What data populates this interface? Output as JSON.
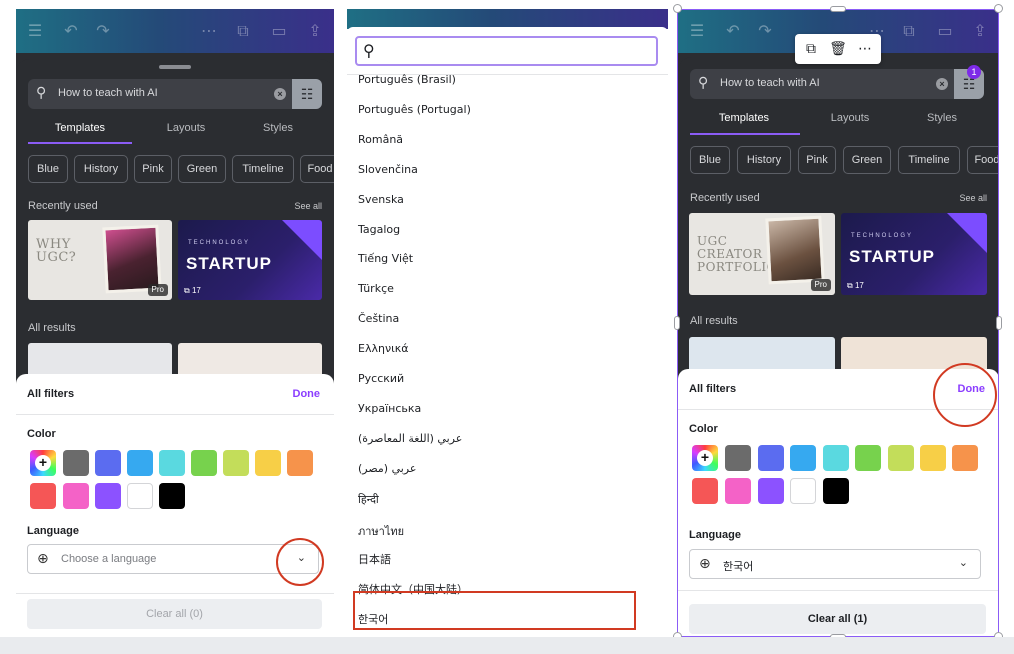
{
  "left": {
    "search_text": "How to teach with AI",
    "tabs": [
      "Templates",
      "Layouts",
      "Styles"
    ],
    "chips": [
      "Blue",
      "History",
      "Pink",
      "Green",
      "Timeline",
      "Food"
    ],
    "recently_used": "Recently used",
    "see_all": "See all",
    "all_results": "All results",
    "thumb_ugc": "WHY\nUGC?",
    "thumb_pro": "Pro",
    "thumb_tech": "TECHNOLOGY",
    "thumb_startup": "STARTUP",
    "thumb_count": "17",
    "filters_title": "All filters",
    "done": "Done",
    "color_label": "Color",
    "language_label": "Language",
    "language_placeholder": "Choose a language",
    "clear_all": "Clear all (0)"
  },
  "middle": {
    "languages": [
      "Português (Brasil)",
      "Português (Portugal)",
      "Română",
      "Slovenčina",
      "Svenska",
      "Tagalog",
      "Tiếng Việt",
      "Türkçe",
      "Čeština",
      "Ελληνικά",
      "Русский",
      "Українська",
      "عربي (اللغة المعاصرة)",
      "عربي (مصر)",
      "हिन्दी",
      "ภาษาไทย",
      "日本語",
      "简体中文（中国大陆）",
      "한국어"
    ]
  },
  "right": {
    "search_text": "How to teach with AI",
    "filter_badge": "1",
    "tabs": [
      "Templates",
      "Layouts",
      "Styles"
    ],
    "chips": [
      "Blue",
      "History",
      "Pink",
      "Green",
      "Timeline",
      "Food"
    ],
    "recently_used": "Recently used",
    "see_all": "See all",
    "all_results": "All results",
    "thumb_ugc": "UGC\nCREATOR\nPORTFOLIO",
    "thumb_pro": "Pro",
    "thumb_tech": "TECHNOLOGY",
    "thumb_startup": "STARTUP",
    "thumb_count": "17",
    "filters_title": "All filters",
    "done": "Done",
    "color_label": "Color",
    "language_label": "Language",
    "language_value": "한국어",
    "clear_all": "Clear all (1)"
  },
  "swatch_colors": [
    "#6b6b6b",
    "#5b6cf0",
    "#36a9f0",
    "#5ad9e0",
    "#77d24d",
    "#c3dd5a",
    "#f7cf47",
    "#f6934b",
    "#f55656",
    "#f462c7",
    "#8c52ff",
    "#ffffff",
    "#000000"
  ],
  "icons": {
    "topbar": [
      "menu-icon",
      "undo-icon",
      "redo-icon",
      "more-icon",
      "shapes-icon",
      "present-icon",
      "share-icon"
    ],
    "float_tools": [
      "duplicate-icon",
      "trash-icon",
      "more-icon"
    ]
  }
}
